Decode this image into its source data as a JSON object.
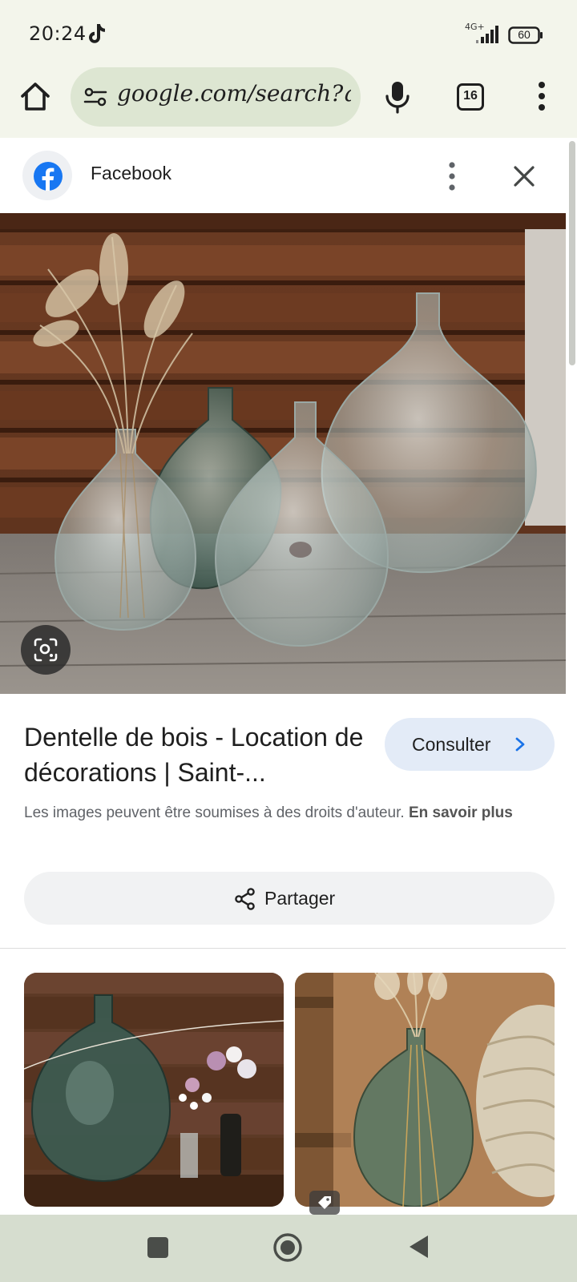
{
  "status_bar": {
    "time": "20:24",
    "network": "4G+",
    "battery": "60"
  },
  "browser": {
    "url": "google.com/search?q=",
    "tab_count": "16"
  },
  "source": {
    "name": "Facebook"
  },
  "result": {
    "title": "Dentelle de bois - Location de décorations | Saint-...",
    "visit_label": "Consulter",
    "copyright_text": "Les images peuvent être soumises à des droits d'auteur.",
    "learn_more": "En savoir plus",
    "share_label": "Partager"
  },
  "icons": {
    "home": "home-icon",
    "site_info": "tune-icon",
    "mic": "mic-icon",
    "tabs": "tabs-icon",
    "menu": "more-vert-icon",
    "source_logo": "facebook-logo",
    "close": "close-icon",
    "lens": "lens-icon",
    "chevron": "chevron-right-icon",
    "share": "share-icon",
    "tag": "tag-icon"
  },
  "colors": {
    "chrome_bg": "#f3f5eb",
    "url_pill": "#dde6d2",
    "facebook_blue": "#1877f2",
    "consult_bg": "#e3ebf7",
    "share_bg": "#f1f2f3",
    "navbar_bg": "#d6ddcf"
  }
}
